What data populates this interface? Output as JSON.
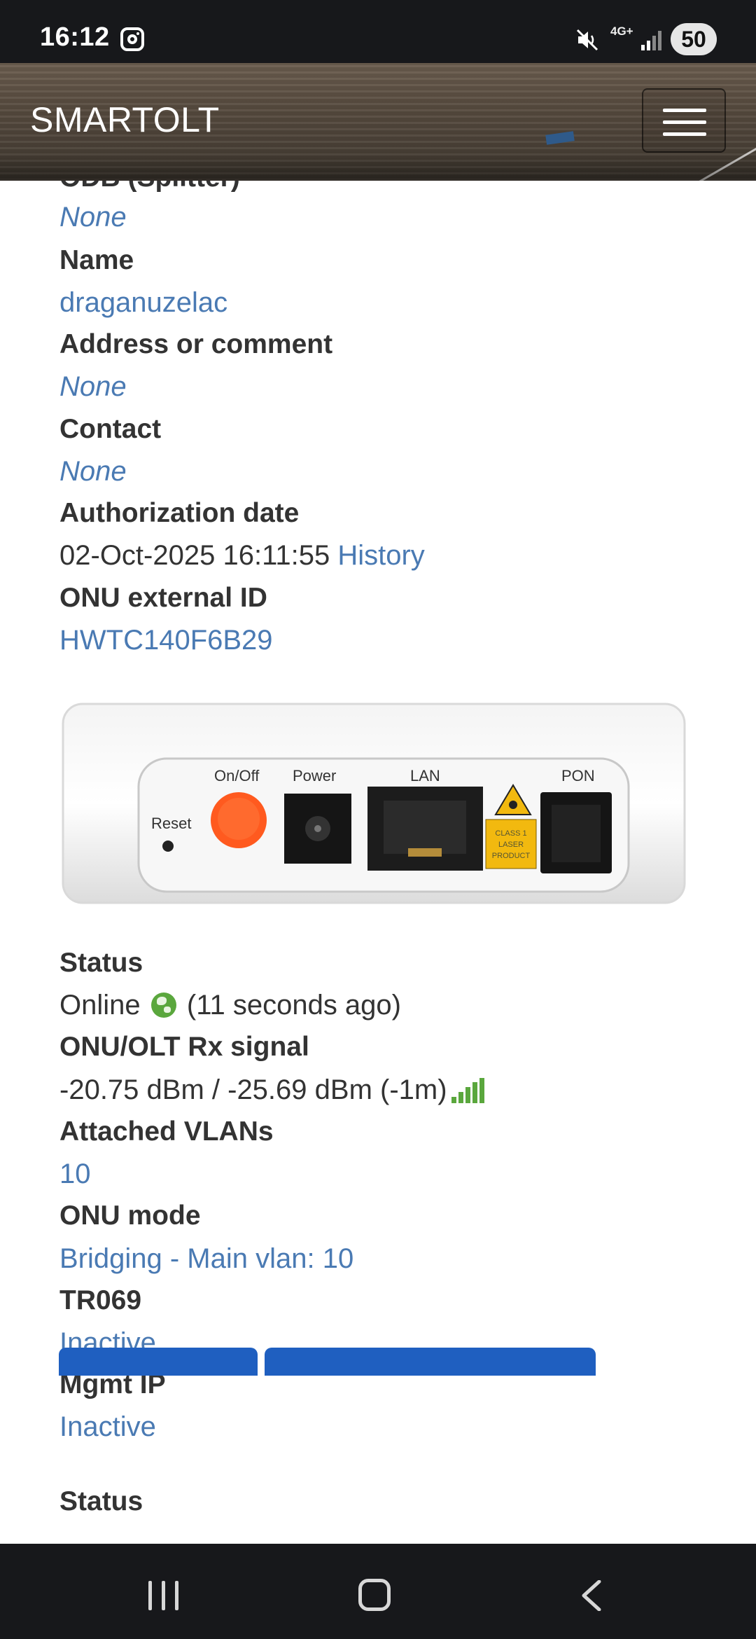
{
  "status_bar": {
    "time": "16:12",
    "network": "4G+",
    "battery": "50",
    "icons": [
      "instagram-icon",
      "mute-icon",
      "signal-icon",
      "battery-icon"
    ]
  },
  "navbar": {
    "brand": "SMARTOLT",
    "menu_icon": "hamburger-icon"
  },
  "fields": {
    "odb_label": "ODB (Splitter)",
    "odb_value": "None",
    "name_label": "Name",
    "name_value": "draganuzelac",
    "address_label": "Address or comment",
    "address_value": "None",
    "contact_label": "Contact",
    "contact_value": "None",
    "auth_label": "Authorization date",
    "auth_value": "02-Oct-2025 16:11:55",
    "auth_history": "History",
    "extid_label": "ONU external ID",
    "extid_value": "HWTC140F6B29",
    "status_label": "Status",
    "status_value": "Online",
    "status_ago": "(11 seconds ago)",
    "rx_label": "ONU/OLT Rx signal",
    "rx_value": "-20.75 dBm / -25.69 dBm (-1m)",
    "vlans_label": "Attached VLANs",
    "vlans_value": "10",
    "mode_label": "ONU mode",
    "mode_value": "Bridging - Main vlan: 10",
    "tr069_label": "TR069",
    "tr069_value": "Inactive",
    "mgmt_label": "Mgmt IP",
    "mgmt_value": "Inactive",
    "status2_label": "Status"
  },
  "device_image": {
    "labels": [
      "On/Off",
      "Power",
      "LAN",
      "PON",
      "Reset"
    ],
    "warning_label": "CLASS 1 LASER PRODUCT"
  },
  "colors": {
    "link": "#4a7ab3",
    "online_green": "#5aa73d",
    "button_blue": "#1f5fc0"
  }
}
